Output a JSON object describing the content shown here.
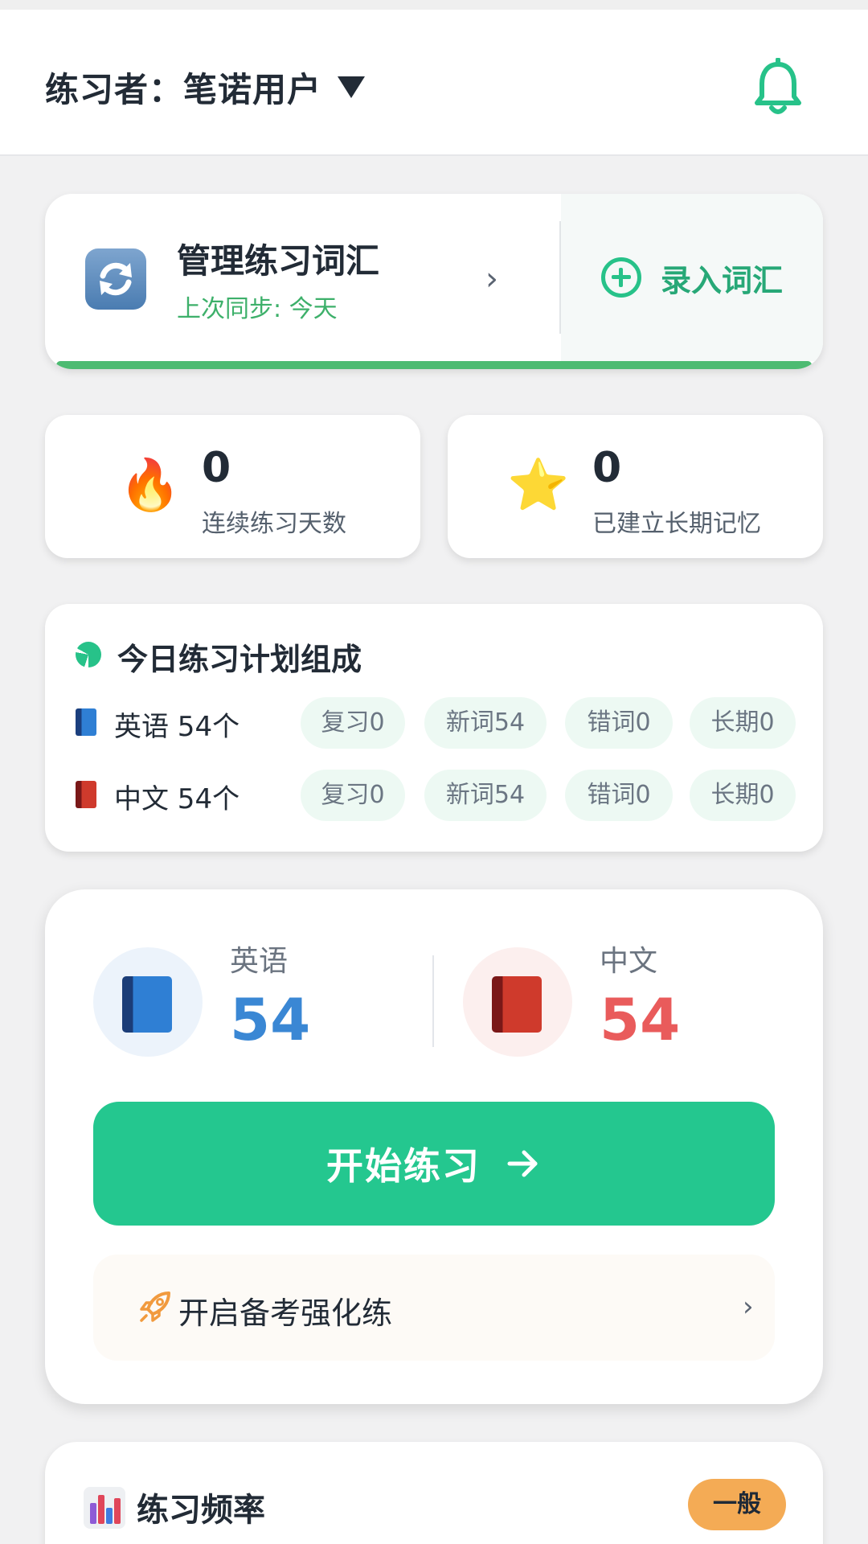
{
  "header": {
    "title": "练习者：笔诺用户",
    "icons": {
      "dropdown": "caret-down-icon",
      "notifications": "bell-icon"
    }
  },
  "manage": {
    "title": "管理练习词汇",
    "subtitle": "上次同步: 今天",
    "add_label": "录入词汇",
    "icons": {
      "sync": "sync-icon",
      "chevron": "chevron-right-icon",
      "add": "plus-circle-icon"
    }
  },
  "stats": [
    {
      "value": "0",
      "label": "连续练习天数",
      "icon": "fire-icon",
      "emoji": "🔥"
    },
    {
      "value": "0",
      "label": "已建立长期记忆",
      "icon": "star-icon",
      "emoji": "⭐"
    }
  ],
  "plan": {
    "title": "今日练习计划组成",
    "rows": [
      {
        "label": "英语 54个",
        "chips": [
          "复习0",
          "新词54",
          "错词0",
          "长期0"
        ]
      },
      {
        "label": "中文 54个",
        "chips": [
          "复习0",
          "新词54",
          "错词0",
          "长期0"
        ]
      }
    ]
  },
  "practice": {
    "english": {
      "name": "英语",
      "count": "54"
    },
    "chinese": {
      "name": "中文",
      "count": "54"
    },
    "start_label": "开始练习",
    "exam_label": "开启备考强化练"
  },
  "frequency": {
    "title": "练习频率",
    "badge": "一般"
  },
  "colors": {
    "accent": "#24c78f",
    "sync_green": "#3db06a",
    "english_blue": "#3a87d4",
    "chinese_red": "#e95b5b",
    "badge_orange": "#f4ab55"
  }
}
